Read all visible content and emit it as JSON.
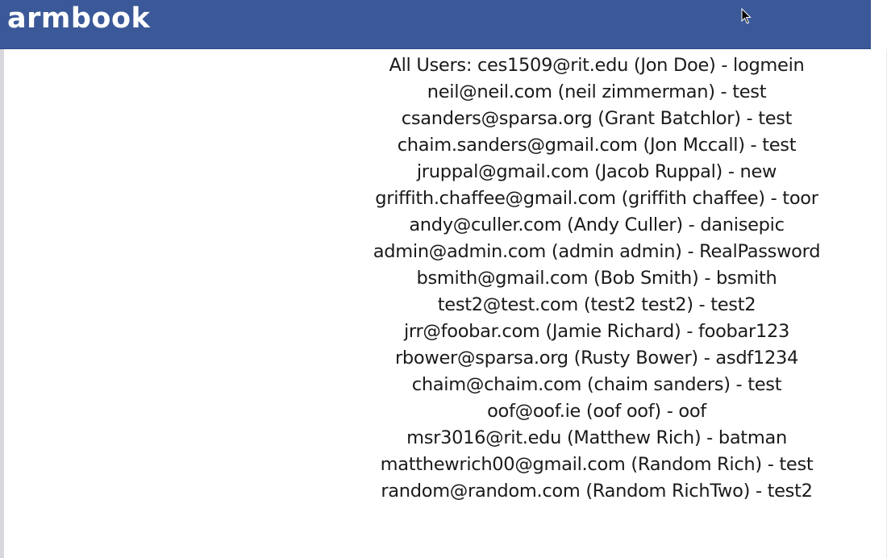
{
  "header": {
    "logo_text": "armbook"
  },
  "users": {
    "prefix": "All Users: ",
    "entries": [
      "ces1509@rit.edu (Jon Doe) - logmein",
      "neil@neil.com (neil zimmerman) - test",
      "csanders@sparsa.org (Grant Batchlor) - test",
      "chaim.sanders@gmail.com (Jon Mccall) - test",
      "jruppal@gmail.com (Jacob Ruppal) - new",
      "griffith.chaffee@gmail.com (griffith chaffee) - toor",
      "andy@culler.com (Andy Culler) - danisepic",
      "admin@admin.com (admin admin) - RealPassword",
      "bsmith@gmail.com (Bob Smith) - bsmith",
      "test2@test.com (test2 test2) - test2",
      "jrr@foobar.com (Jamie Richard) - foobar123",
      "rbower@sparsa.org (Rusty Bower) - asdf1234",
      "chaim@chaim.com (chaim sanders) - test",
      "oof@oof.ie (oof oof) - oof",
      "msr3016@rit.edu (Matthew Rich) - batman",
      "matthewrich00@gmail.com (Random Rich) - test",
      "random@random.com (Random RichTwo) - test2"
    ]
  },
  "colors": {
    "header_bg": "#3b5998",
    "logo_text": "#ffffff",
    "page_bg": "#ffffff",
    "text": "#1a1a1a"
  },
  "icons": {
    "cursor": "mouse-pointer-icon"
  }
}
